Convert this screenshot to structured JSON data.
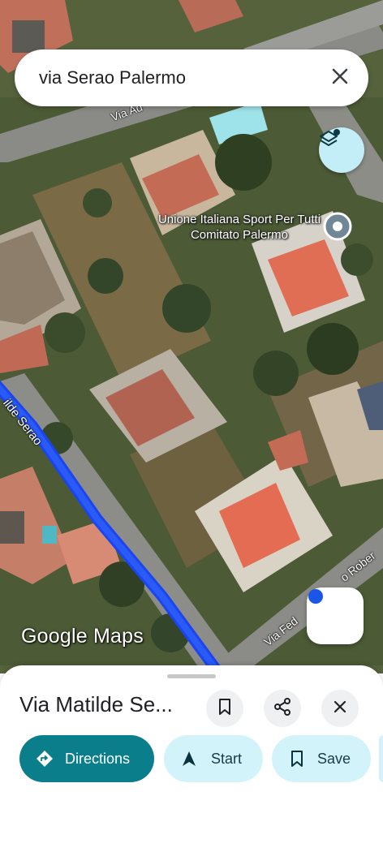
{
  "search": {
    "query": "via Serao Palermo",
    "clear_icon": "close-icon"
  },
  "map": {
    "poi_label": "Unione Italiana Sport Per Tutti Comitato Palermo",
    "street_labels": [
      "Via Ad",
      "ilde Serao",
      "Via Fed",
      "o Rober"
    ],
    "logo_text": "Google Maps",
    "layers_icon": "layers-icon",
    "location_icon": "my-location-icon",
    "route_color": "#1a45f0"
  },
  "place": {
    "title": "Via Matilde Se...",
    "actions": [
      "bookmark-icon",
      "share-icon",
      "close-icon"
    ]
  },
  "buttons": {
    "directions": "Directions",
    "start": "Start",
    "save": "Save"
  },
  "colors": {
    "primary": "#0b7e8c",
    "secondary": "#d3f3fb",
    "accent_blue": "#1a73e8"
  }
}
